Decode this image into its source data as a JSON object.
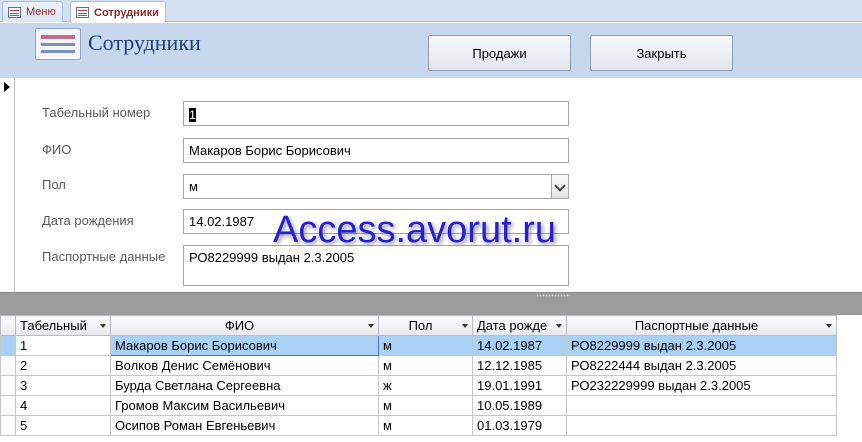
{
  "tabs": [
    {
      "label": "Меню",
      "active": false
    },
    {
      "label": "Сотрудники",
      "active": true
    }
  ],
  "form": {
    "title": "Сотрудники",
    "buttons": {
      "sales": "Продажи",
      "close": "Закрыть"
    },
    "fields": {
      "tab_number": {
        "label": "Табельный номер",
        "value": "1"
      },
      "fio": {
        "label": "ФИО",
        "value": "Макаров Борис Борисович"
      },
      "gender": {
        "label": "Пол",
        "value": "м"
      },
      "birth_date": {
        "label": "Дата рождения",
        "value": "14.02.1987"
      },
      "passport": {
        "label": "Паспортные данные",
        "value": "РО8229999 выдан 2.3.2005"
      }
    }
  },
  "watermark": "Access.avorut.ru",
  "datasheet": {
    "columns": [
      "Табельный",
      "ФИО",
      "Пол",
      "Дата рожде",
      "Паспортные данные"
    ],
    "rows": [
      [
        "1",
        "Макаров Борис Борисович",
        "м",
        "14.02.1987",
        "РО8229999 выдан 2.3.2005"
      ],
      [
        "2",
        "Волков Денис Семёнович",
        "м",
        "12.12.1985",
        "РО8222444 выдан 2.3.2005"
      ],
      [
        "3",
        "Бурда Светлана Сергеевна",
        "ж",
        "19.01.1991",
        "РО232229999 выдан 2.3.2005"
      ],
      [
        "4",
        "Громов Максим Васильевич",
        "м",
        "10.05.1989",
        ""
      ],
      [
        "5",
        "Осипов Роман Евгеньевич",
        "м",
        "01.03.1979",
        ""
      ]
    ]
  },
  "colors": {
    "header_bg": "#c7d8ee",
    "title": "#1e3f73",
    "selected_row": "#a9d1f5",
    "watermark": "#2a1fd0"
  }
}
